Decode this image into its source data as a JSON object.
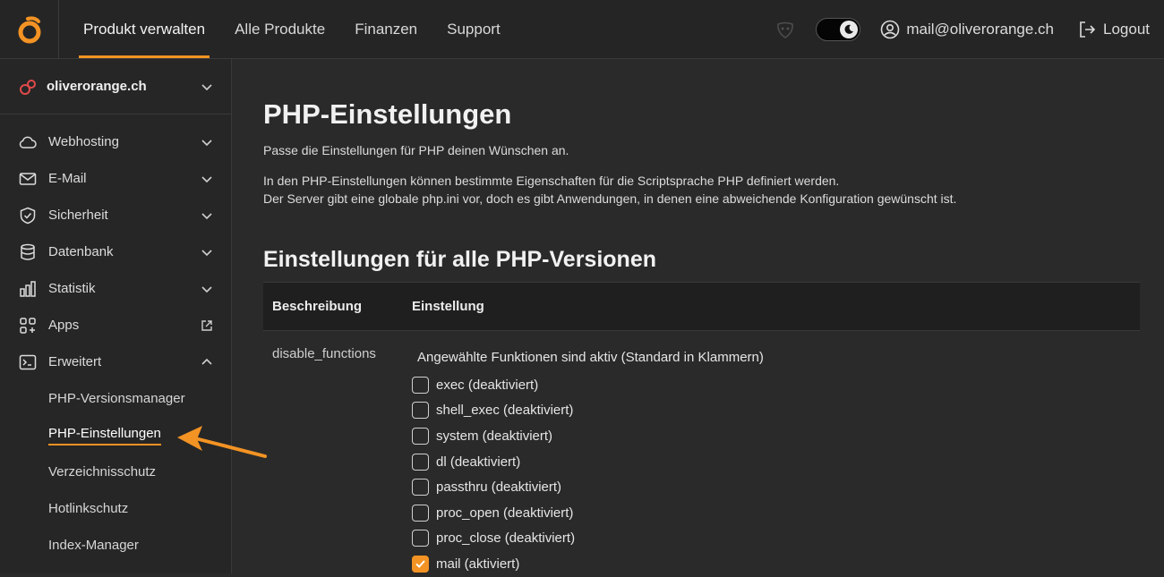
{
  "topbar": {
    "nav": [
      {
        "label": "Produkt verwalten",
        "active": true
      },
      {
        "label": "Alle Produkte"
      },
      {
        "label": "Finanzen"
      },
      {
        "label": "Support"
      }
    ],
    "user_email": "mail@oliverorange.ch",
    "logout_label": "Logout",
    "theme": "dark"
  },
  "sidebar": {
    "domain": "oliverorange.ch",
    "items": [
      {
        "label": "Webhosting",
        "icon": "cloud-icon",
        "expanded": false
      },
      {
        "label": "E-Mail",
        "icon": "mail-icon",
        "expanded": false
      },
      {
        "label": "Sicherheit",
        "icon": "shield-icon",
        "expanded": false
      },
      {
        "label": "Datenbank",
        "icon": "database-icon",
        "expanded": false
      },
      {
        "label": "Statistik",
        "icon": "bar-chart-icon",
        "expanded": false
      },
      {
        "label": "Apps",
        "icon": "apps-grid-icon",
        "external": true
      },
      {
        "label": "Erweitert",
        "icon": "terminal-icon",
        "expanded": true
      }
    ],
    "sub_items": [
      {
        "label": "PHP-Versionsmanager"
      },
      {
        "label": "PHP-Einstellungen",
        "active": true
      },
      {
        "label": "Verzeichnisschutz"
      },
      {
        "label": "Hotlinkschutz"
      },
      {
        "label": "Index-Manager"
      }
    ]
  },
  "main": {
    "title": "PHP-Einstellungen",
    "lead": "Passe die Einstellungen für PHP deinen Wünschen an.",
    "desc_line1": "In den PHP-Einstellungen können bestimmte Eigenschaften für die Scriptsprache PHP definiert werden.",
    "desc_line2": "Der Server gibt eine globale php.ini vor, doch es gibt Anwendungen, in denen eine abweichende Konfiguration gewünscht ist.",
    "section_title": "Einstellungen für alle PHP-Versionen",
    "table": {
      "headers": [
        "Beschreibung",
        "Einstellung"
      ],
      "row": {
        "name": "disable_functions",
        "hint": "Angewählte Funktionen sind aktiv (Standard in Klammern)",
        "options": [
          {
            "label": "exec (deaktiviert)",
            "checked": false
          },
          {
            "label": "shell_exec (deaktiviert)",
            "checked": false
          },
          {
            "label": "system (deaktiviert)",
            "checked": false
          },
          {
            "label": "dl (deaktiviert)",
            "checked": false
          },
          {
            "label": "passthru (deaktiviert)",
            "checked": false
          },
          {
            "label": "proc_open (deaktiviert)",
            "checked": false
          },
          {
            "label": "proc_close (deaktiviert)",
            "checked": false
          },
          {
            "label": "mail (aktiviert)",
            "checked": true
          }
        ]
      }
    }
  },
  "colors": {
    "accent": "#f39324",
    "background": "#2a2a2a",
    "panel": "#262626"
  }
}
